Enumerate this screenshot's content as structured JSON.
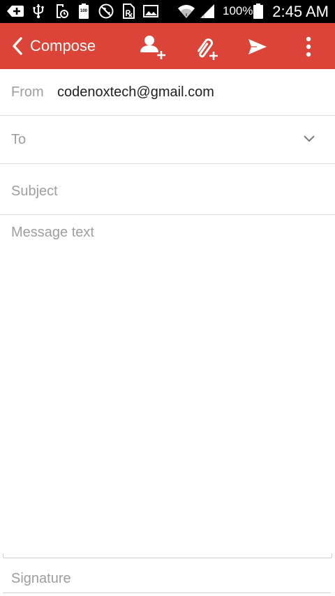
{
  "status_bar": {
    "battery_level_text": "100",
    "battery_percent": "100%",
    "time": "2:45 AM"
  },
  "app_bar": {
    "title": "Compose",
    "background_color": "#dc4437"
  },
  "compose": {
    "from_label": "From",
    "from_value": "codenoxtech@gmail.com",
    "to_placeholder": "To",
    "subject_placeholder": "Subject",
    "body_placeholder": "Message text",
    "signature_placeholder": "Signature"
  }
}
